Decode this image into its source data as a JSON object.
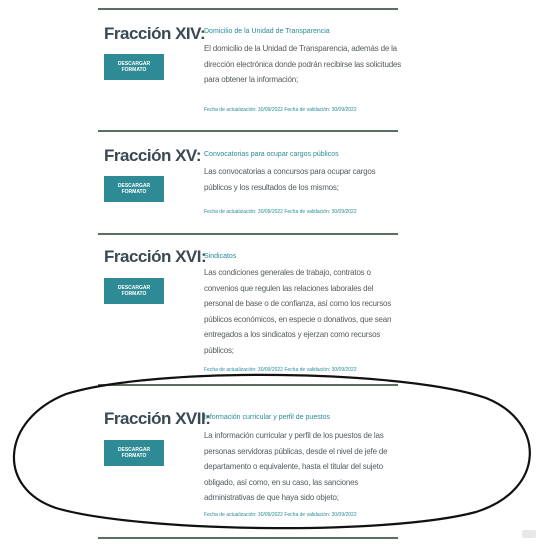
{
  "sections": [
    {
      "title": "Fracción XIV:",
      "button": "DESCARGAR FORMATO",
      "link": "Domicilio de la Unidad de Transparencia",
      "description": "El domicilio de la Unidad de Transparencia, además de la dirección electrónica donde podrán recibirse las solicitudes para obtener la información;",
      "dates": "Fecha de actualización: 30/09/2022 Fecha de validación: 30/09/2022"
    },
    {
      "title": "Fracción XV:",
      "button": "DESCARGAR FORMATO",
      "link": "Convocatorias para ocupar cargos públicos",
      "description": "Las convocatorias a concursos para ocupar cargos públicos y los resultados de los mismos;",
      "dates": "Fecha de actualización: 30/09/2022 Fecha de validación: 30/09/2022"
    },
    {
      "title": "Fracción XVI:",
      "button": "DESCARGAR FORMATO",
      "link": "Sindicatos",
      "description": "Las condiciones generales de trabajo, contratos o convenios que regulen las relaciones laborales del personal de base o de confianza, así como los recursos públicos económicos, en especie o donativos, que sean entregados a los sindicatos y ejerzan como recursos públicos;",
      "dates": "Fecha de actualización: 30/09/2022 Fecha de validación: 30/09/2022"
    },
    {
      "title": "Fracción XVII:",
      "button": "DESCARGAR FORMATO",
      "link": "Información curricular y perfil de puestos",
      "description": "La información curricular y perfil de los puestos de las personas servidoras públicas, desde el nivel de jefe de departamento o equivalente, hasta el titular del sujeto obligado, así como, en su caso, las sanciones administrativas de que haya sido objeto;",
      "dates": "Fecha de actualización: 30/09/2022 Fecha de validación: 30/09/2022"
    }
  ],
  "annotation_color": "#111111",
  "accent_color": "#2e8b95"
}
